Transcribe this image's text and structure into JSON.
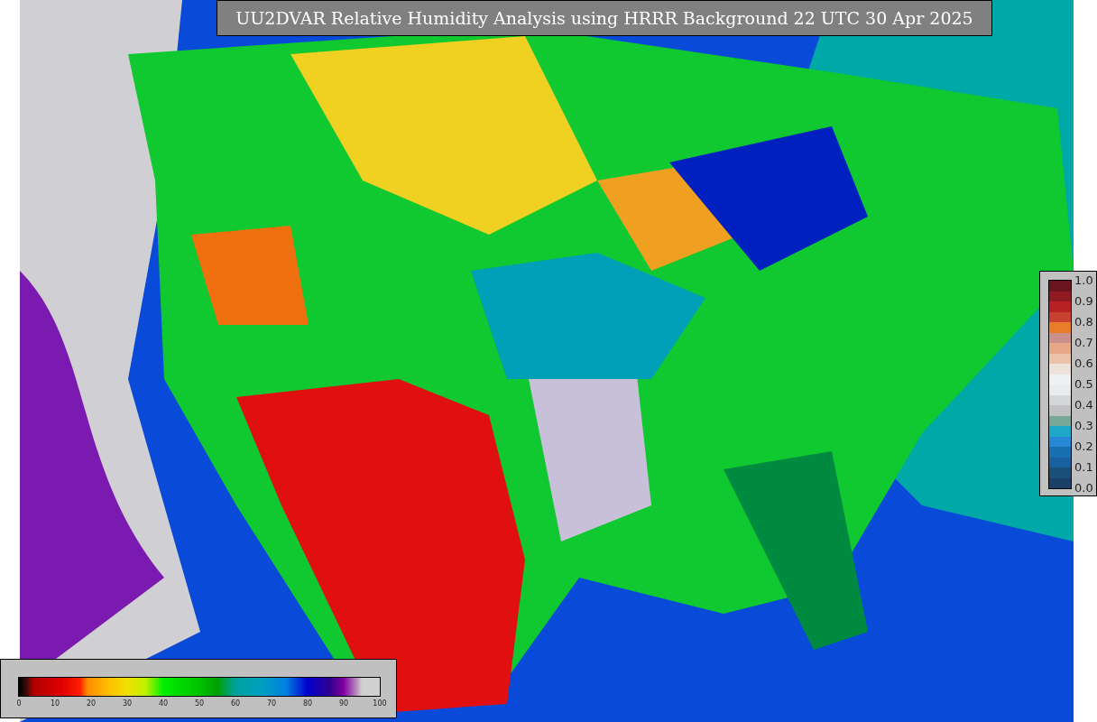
{
  "title": "UU2DVAR Relative Humidity Analysis using HRRR Background 22 UTC 30 Apr 2025",
  "humidity_colorbar": {
    "ticks": [
      "0",
      "10",
      "20",
      "30",
      "40",
      "50",
      "60",
      "70",
      "80",
      "90",
      "100"
    ]
  },
  "ratio_colorbar": {
    "ticks": [
      "1.0",
      "0.9",
      "0.8",
      "0.7",
      "0.6",
      "0.5",
      "0.4",
      "0.3",
      "0.2",
      "0.1",
      "0.0"
    ]
  }
}
